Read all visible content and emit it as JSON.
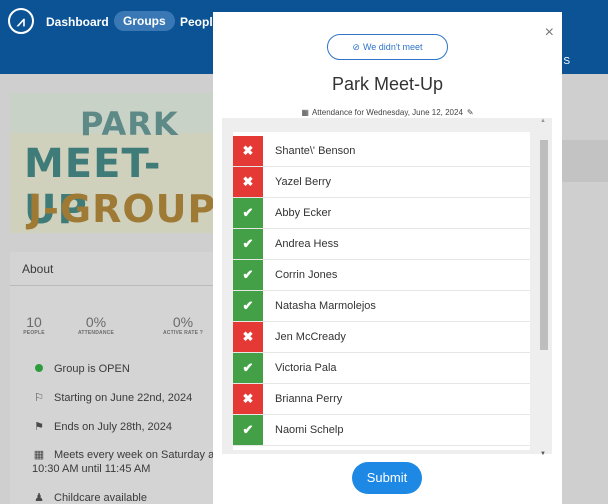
{
  "nav": {
    "items": [
      "Dashboard",
      "Groups",
      "People"
    ],
    "right_fragment": "S"
  },
  "banner": {
    "line1": "PARK",
    "line2": "MEET-UP",
    "line3": "J-GROUP"
  },
  "about": {
    "heading": "About",
    "stats": [
      {
        "value": "10",
        "label": "PEOPLE"
      },
      {
        "value": "0%",
        "label": "ATTENDANCE"
      },
      {
        "value": "0%",
        "label": "ACTIVE RATE"
      }
    ],
    "info": [
      {
        "icon": "status-dot",
        "text": "Group is OPEN"
      },
      {
        "icon": "flag-icon",
        "text": "Starting on June 22nd, 2024"
      },
      {
        "icon": "finish-flag-icon",
        "text": "Ends on July 28th, 2024"
      },
      {
        "icon": "calendar-icon",
        "text": "Meets every week on Saturday at",
        "text2": "10:30 AM until 11:45 AM"
      },
      {
        "icon": "childcare-icon",
        "text": "Childcare available"
      }
    ]
  },
  "modal": {
    "no_meet_label": "We didn't meet",
    "title": "Park Meet-Up",
    "attendance_line": "Attendance for Wednesday, June 12, 2024",
    "close_glyph": "×",
    "submit_label": "Submit",
    "colors": {
      "absent": "#e53935",
      "present": "#43a047",
      "accent": "#1e88e5"
    },
    "members": [
      {
        "name": "Shante\\' Benson",
        "present": false
      },
      {
        "name": "Yazel Berry",
        "present": false
      },
      {
        "name": "Abby Ecker",
        "present": true
      },
      {
        "name": "Andrea Hess",
        "present": true
      },
      {
        "name": "Corrin Jones",
        "present": true
      },
      {
        "name": "Natasha Marmolejos",
        "present": true
      },
      {
        "name": "Jen McCready",
        "present": false
      },
      {
        "name": "Victoria Pala",
        "present": true
      },
      {
        "name": "Brianna Perry",
        "present": false
      },
      {
        "name": "Naomi Schelp",
        "present": true
      }
    ]
  }
}
